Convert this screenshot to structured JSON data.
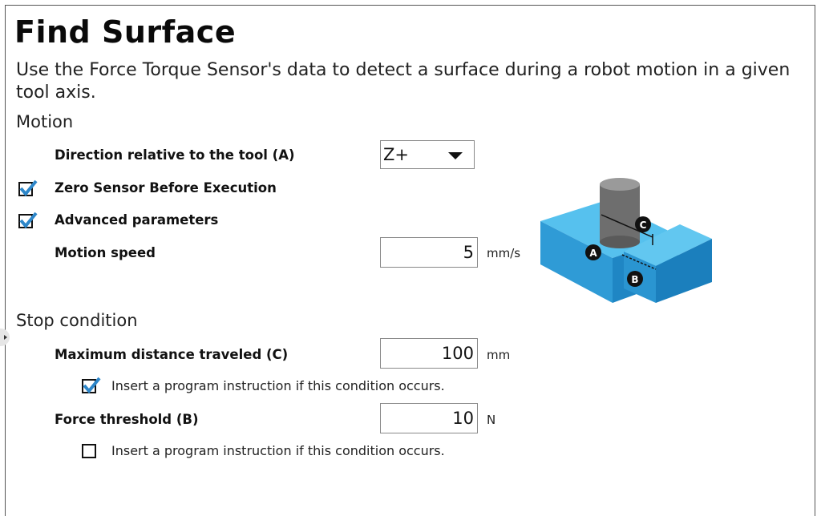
{
  "title": "Find Surface",
  "description": "Use the Force Torque Sensor's data to detect a surface during a robot motion in a given tool axis.",
  "motion": {
    "heading": "Motion",
    "direction_label": "Direction relative to the tool (A)",
    "direction_value": "Z+",
    "zero_sensor_label": "Zero Sensor Before Execution",
    "zero_sensor_checked": true,
    "advanced_label": "Advanced parameters",
    "advanced_checked": true,
    "speed_label": "Motion speed",
    "speed_value": "5",
    "speed_unit": "mm/s"
  },
  "stop": {
    "heading": "Stop condition",
    "max_distance_label": "Maximum distance traveled (C)",
    "max_distance_value": "100",
    "max_distance_unit": "mm",
    "distance_insert_label": "Insert a program instruction if this condition occurs.",
    "distance_insert_checked": true,
    "force_label": "Force threshold (B)",
    "force_value": "10",
    "force_unit": "N",
    "force_insert_label": "Insert a program instruction if this condition occurs.",
    "force_insert_checked": false
  },
  "illustration": {
    "marker_a": "A",
    "marker_b": "B",
    "marker_c": "C",
    "block_color": "#3fa9e0"
  },
  "colors": {
    "check": "#2d86c9"
  }
}
